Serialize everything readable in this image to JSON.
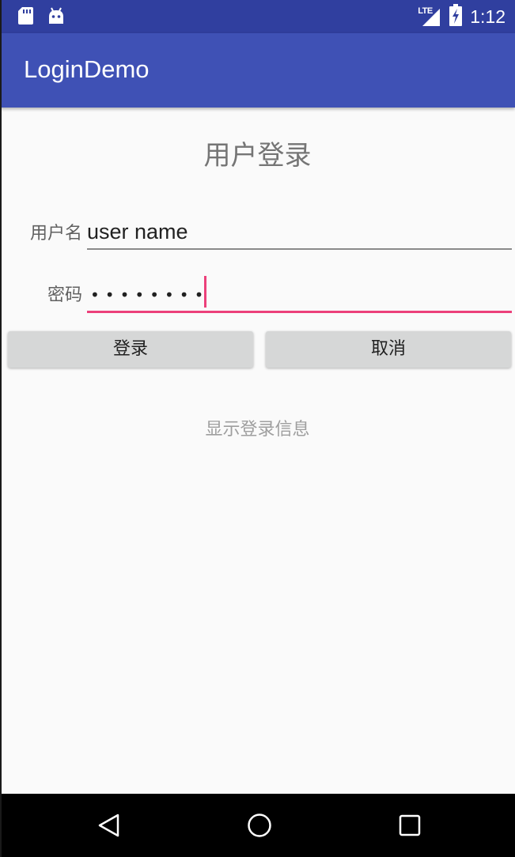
{
  "status_bar": {
    "time": "1:12",
    "network": "LTE",
    "icons": [
      "sd-card-icon",
      "android-icon",
      "signal-icon",
      "battery-charging-icon"
    ]
  },
  "app_bar": {
    "title": "LoginDemo"
  },
  "login_form": {
    "title": "用户登录",
    "username_label": "用户名",
    "username_value": "user name",
    "password_label": "密码",
    "password_masked": "••••••••",
    "login_button": "登录",
    "cancel_button": "取消",
    "info_text": "显示登录信息"
  },
  "nav_bar": {
    "icons": [
      "back-icon",
      "home-icon",
      "recent-apps-icon"
    ]
  },
  "colors": {
    "status_bar": "#303f9f",
    "app_bar": "#3f51b5",
    "accent": "#ec407a",
    "button": "#d6d7d7",
    "background": "#fafafa"
  }
}
